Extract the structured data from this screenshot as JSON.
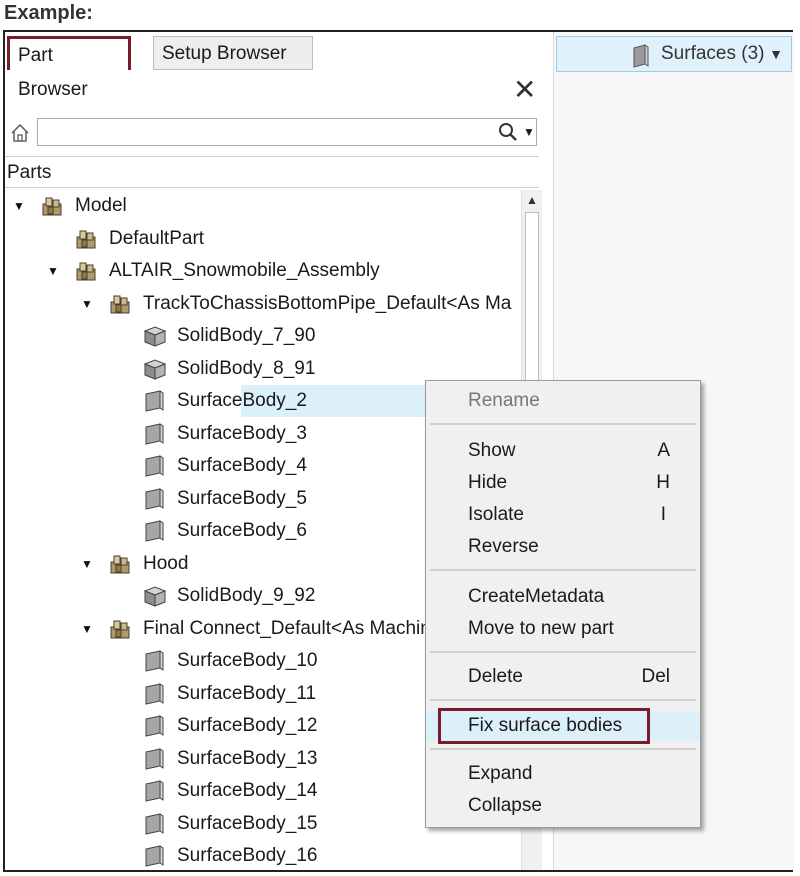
{
  "example_label": "Example:",
  "tabs": {
    "part_browser": "Part Browser",
    "setup_browser": "Setup Browser"
  },
  "surfaces_dropdown": {
    "label": "Surfaces (3)"
  },
  "tree_header": "Parts",
  "tree": [
    {
      "label": "Model",
      "level": 0,
      "icon": "assembly-icon",
      "expanded": true
    },
    {
      "label": "DefaultPart",
      "level": 1,
      "icon": "assembly-icon"
    },
    {
      "label": "ALTAIR_Snowmobile_Assembly",
      "level": 1,
      "icon": "assembly-icon",
      "expanded": true
    },
    {
      "label": "TrackToChassisBottomPipe_Default<As Ma",
      "level": 2,
      "icon": "assembly-icon",
      "expanded": true
    },
    {
      "label": "SolidBody_7_90",
      "level": 3,
      "icon": "solid-body-icon"
    },
    {
      "label": "SolidBody_8_91",
      "level": 3,
      "icon": "solid-body-icon"
    },
    {
      "label": "SurfaceBody_2",
      "level": 3,
      "icon": "surface-body-icon",
      "selected": true
    },
    {
      "label": "SurfaceBody_3",
      "level": 3,
      "icon": "surface-body-icon"
    },
    {
      "label": "SurfaceBody_4",
      "level": 3,
      "icon": "surface-body-icon"
    },
    {
      "label": "SurfaceBody_5",
      "level": 3,
      "icon": "surface-body-icon"
    },
    {
      "label": "SurfaceBody_6",
      "level": 3,
      "icon": "surface-body-icon"
    },
    {
      "label": "Hood",
      "level": 2,
      "icon": "assembly-icon",
      "expanded": true
    },
    {
      "label": "SolidBody_9_92",
      "level": 3,
      "icon": "solid-body-icon"
    },
    {
      "label": "Final Connect_Default<As Machin",
      "level": 2,
      "icon": "assembly-icon",
      "expanded": true
    },
    {
      "label": "SurfaceBody_10",
      "level": 3,
      "icon": "surface-body-icon"
    },
    {
      "label": "SurfaceBody_11",
      "level": 3,
      "icon": "surface-body-icon"
    },
    {
      "label": "SurfaceBody_12",
      "level": 3,
      "icon": "surface-body-icon"
    },
    {
      "label": "SurfaceBody_13",
      "level": 3,
      "icon": "surface-body-icon"
    },
    {
      "label": "SurfaceBody_14",
      "level": 3,
      "icon": "surface-body-icon"
    },
    {
      "label": "SurfaceBody_15",
      "level": 3,
      "icon": "surface-body-icon"
    },
    {
      "label": "SurfaceBody_16",
      "level": 3,
      "icon": "surface-body-icon"
    }
  ],
  "context_menu": {
    "rename": "Rename",
    "show": "Show",
    "show_key": "A",
    "hide": "Hide",
    "hide_key": "H",
    "isolate": "Isolate",
    "isolate_key": "I",
    "reverse": "Reverse",
    "create_metadata": "CreateMetadata",
    "move_to_new_part": "Move to new part",
    "delete": "Delete",
    "delete_key": "Del",
    "fix_surface_bodies": "Fix surface bodies",
    "expand": "Expand",
    "collapse": "Collapse"
  },
  "colors": {
    "highlight_outline": "#7a1b2c",
    "selection": "#dcf0fa"
  }
}
